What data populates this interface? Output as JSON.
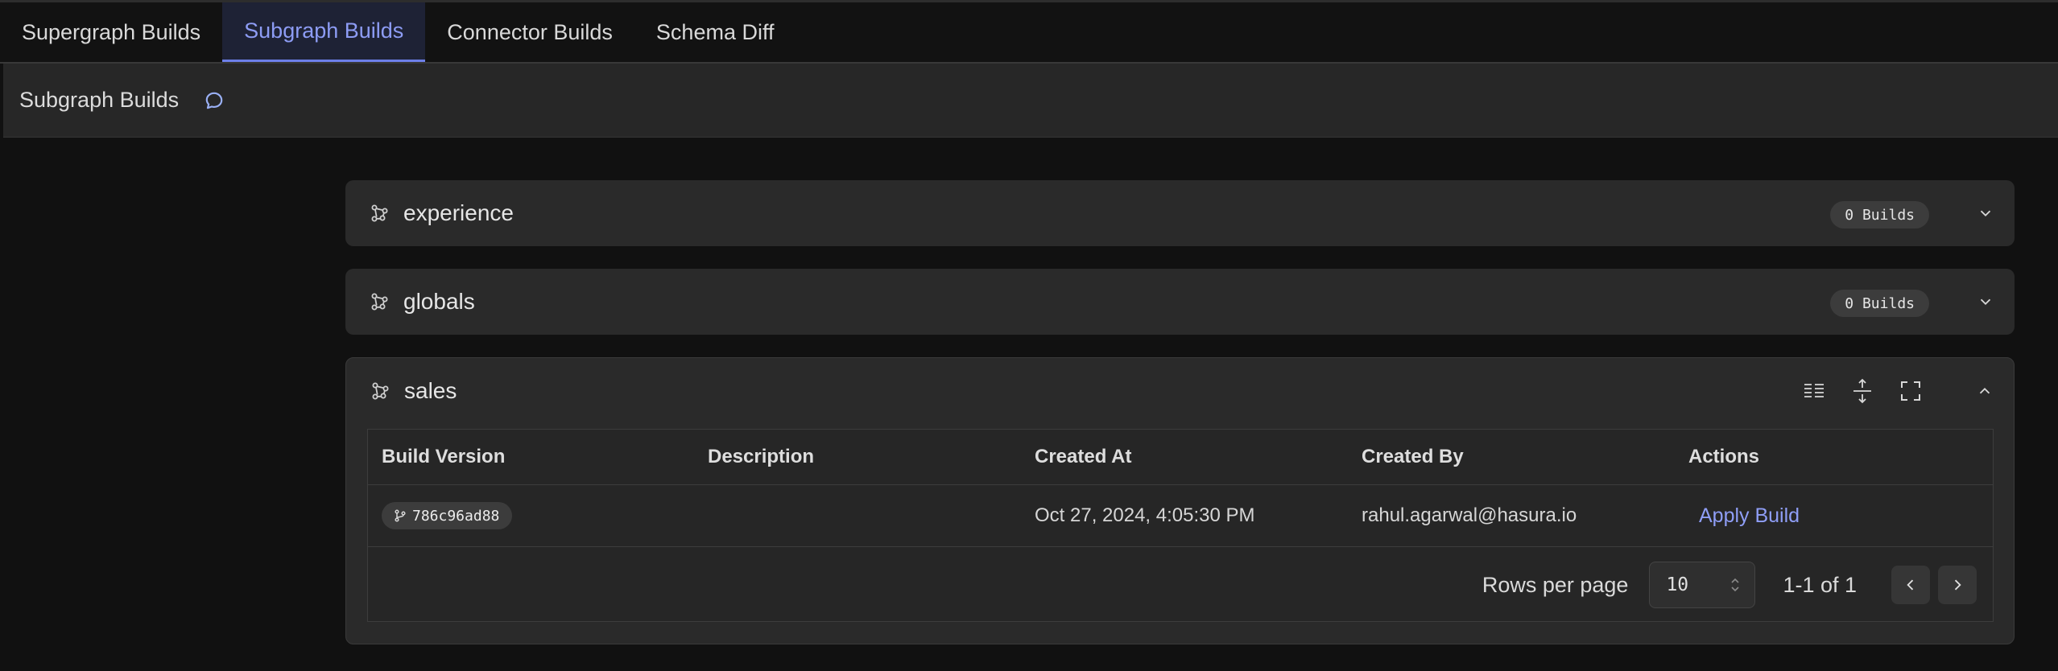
{
  "tabs": [
    {
      "label": "Supergraph Builds",
      "active": false
    },
    {
      "label": "Subgraph Builds",
      "active": true
    },
    {
      "label": "Connector Builds",
      "active": false
    },
    {
      "label": "Schema Diff",
      "active": false
    }
  ],
  "subheader": {
    "title": "Subgraph Builds",
    "icon": "chat-bubble-icon"
  },
  "subgraphs": [
    {
      "name": "experience",
      "badge": "0 Builds",
      "expanded": false
    },
    {
      "name": "globals",
      "badge": "0 Builds",
      "expanded": false
    },
    {
      "name": "sales",
      "expanded": true
    }
  ],
  "table": {
    "headers": [
      "Build Version",
      "Description",
      "Created At",
      "Created By",
      "Actions"
    ],
    "rows": [
      {
        "version": "786c96ad88",
        "description": "",
        "created_at": "Oct 27, 2024, 4:05:30 PM",
        "created_by": "rahul.agarwal@hasura.io",
        "action": "Apply Build"
      }
    ]
  },
  "pagination": {
    "rows_per_page_label": "Rows per page",
    "rows_per_page": "10",
    "range": "1-1 of 1"
  },
  "colors": {
    "accent": "#8d9cf4",
    "background": "#111111",
    "panel": "#2a2a2a"
  }
}
